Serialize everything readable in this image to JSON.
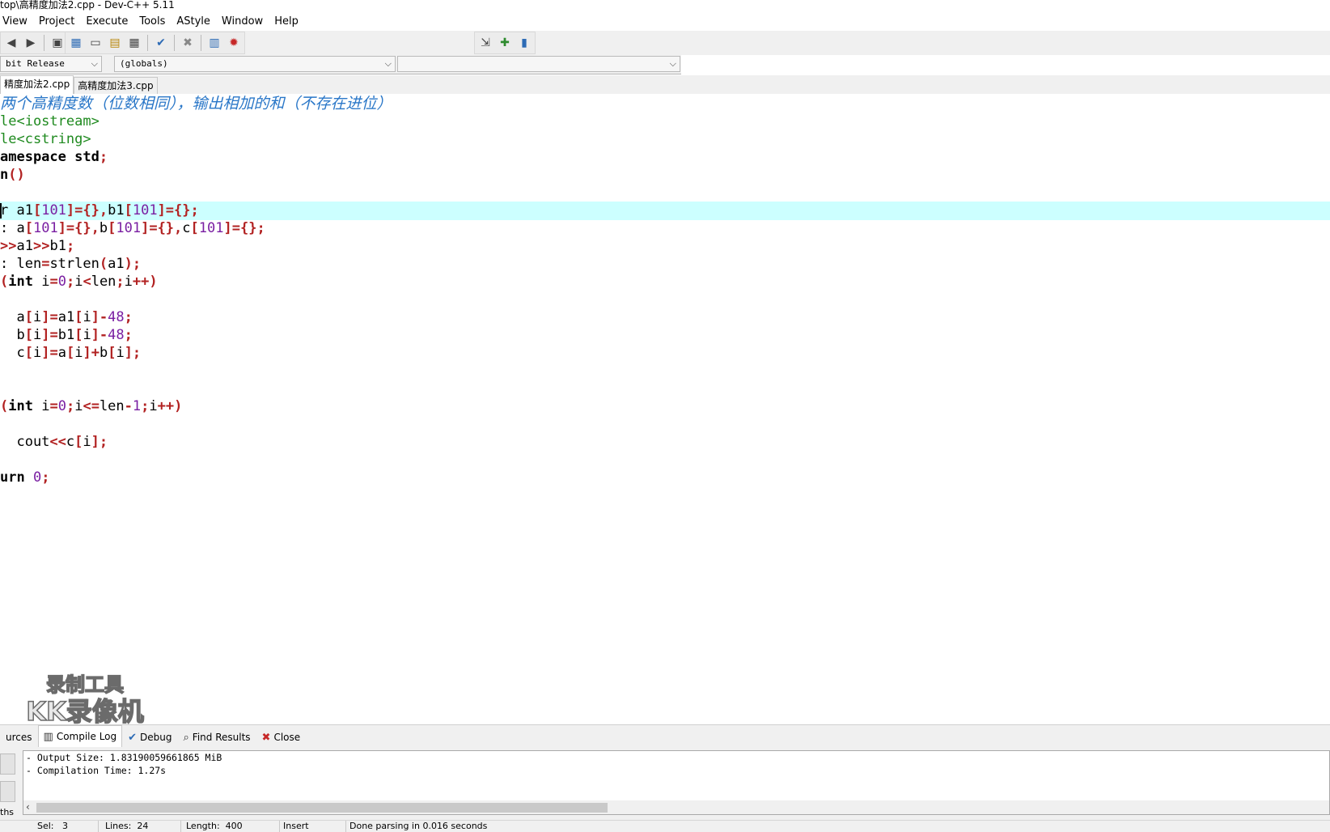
{
  "window": {
    "title": "top\\高精度加法2.cpp - Dev-C++ 5.11"
  },
  "menu": [
    "View",
    "Project",
    "Execute",
    "Tools",
    "AStyle",
    "Window",
    "Help"
  ],
  "toolbar": {
    "group1": [
      "undo-icon",
      "redo-icon",
      "save-icon"
    ],
    "group2": [
      "new-class-icon",
      "window-icon",
      "table-icon",
      "grid-icon",
      "check-icon",
      "delete-icon",
      "chart-icon",
      "bug-icon"
    ],
    "group3": [
      "goto-icon",
      "add-bookmark-icon",
      "bookmark-icon"
    ]
  },
  "selectors": {
    "compiler": "bit Release",
    "scope": "(globals)",
    "members": ""
  },
  "file_tabs": [
    "精度加法2.cpp",
    "高精度加法3.cpp"
  ],
  "colors": {
    "comment": "#2a77c8",
    "preprocessor": "#1f8a1f",
    "symbol": "#b22222",
    "number": "#7a1fa2",
    "highlight": "#ccffff"
  },
  "code_lines": [
    {
      "type": "comment",
      "parts": [
        [
          "两个高精度数（位数相同），输出相加的和（不存在进位）",
          "c"
        ]
      ]
    },
    {
      "type": "pre",
      "parts": [
        [
          "le<iostream>",
          "p"
        ]
      ]
    },
    {
      "type": "pre",
      "parts": [
        [
          "le<cstring>",
          "p"
        ]
      ]
    },
    {
      "type": "code",
      "parts": [
        [
          "amespace std",
          "b"
        ],
        [
          ";",
          "s"
        ]
      ]
    },
    {
      "type": "code",
      "parts": [
        [
          "n",
          "b"
        ],
        [
          "()",
          "s"
        ]
      ]
    },
    {
      "type": "code",
      "parts": []
    },
    {
      "type": "code",
      "hl": true,
      "parts": [
        [
          "r a1",
          "t"
        ],
        [
          "[",
          "s"
        ],
        [
          "101",
          "n"
        ],
        [
          "]={},",
          "s"
        ],
        [
          "b1",
          "t"
        ],
        [
          "[",
          "s"
        ],
        [
          "101",
          "n"
        ],
        [
          "]={};",
          "s"
        ]
      ]
    },
    {
      "type": "code",
      "parts": [
        [
          ": a",
          "t"
        ],
        [
          "[",
          "s"
        ],
        [
          "101",
          "n"
        ],
        [
          "]={},",
          "s"
        ],
        [
          "b",
          "t"
        ],
        [
          "[",
          "s"
        ],
        [
          "101",
          "n"
        ],
        [
          "]={},",
          "s"
        ],
        [
          "c",
          "t"
        ],
        [
          "[",
          "s"
        ],
        [
          "101",
          "n"
        ],
        [
          "]={};",
          "s"
        ]
      ]
    },
    {
      "type": "code",
      "parts": [
        [
          ">>",
          "s"
        ],
        [
          "a1",
          "t"
        ],
        [
          ">>",
          "s"
        ],
        [
          "b1",
          "t"
        ],
        [
          ";",
          "s"
        ]
      ]
    },
    {
      "type": "code",
      "parts": [
        [
          ": len",
          "t"
        ],
        [
          "=",
          "s"
        ],
        [
          "strlen",
          "t"
        ],
        [
          "(",
          "s"
        ],
        [
          "a1",
          "t"
        ],
        [
          ");",
          "s"
        ]
      ]
    },
    {
      "type": "code",
      "parts": [
        [
          "(",
          "s"
        ],
        [
          "int",
          "b"
        ],
        [
          " i",
          "t"
        ],
        [
          "=",
          "s"
        ],
        [
          "0",
          "n"
        ],
        [
          ";",
          "s"
        ],
        [
          "i",
          "t"
        ],
        [
          "<",
          "s"
        ],
        [
          "len",
          "t"
        ],
        [
          ";",
          "s"
        ],
        [
          "i",
          "t"
        ],
        [
          "++)",
          "s"
        ]
      ]
    },
    {
      "type": "code",
      "parts": []
    },
    {
      "type": "code",
      "parts": [
        [
          "  a",
          "t"
        ],
        [
          "[",
          "s"
        ],
        [
          "i",
          "t"
        ],
        [
          "]=",
          "s"
        ],
        [
          "a1",
          "t"
        ],
        [
          "[",
          "s"
        ],
        [
          "i",
          "t"
        ],
        [
          "]-",
          "s"
        ],
        [
          "48",
          "n"
        ],
        [
          ";",
          "s"
        ]
      ]
    },
    {
      "type": "code",
      "parts": [
        [
          "  b",
          "t"
        ],
        [
          "[",
          "s"
        ],
        [
          "i",
          "t"
        ],
        [
          "]=",
          "s"
        ],
        [
          "b1",
          "t"
        ],
        [
          "[",
          "s"
        ],
        [
          "i",
          "t"
        ],
        [
          "]-",
          "s"
        ],
        [
          "48",
          "n"
        ],
        [
          ";",
          "s"
        ]
      ]
    },
    {
      "type": "code",
      "parts": [
        [
          "  c",
          "t"
        ],
        [
          "[",
          "s"
        ],
        [
          "i",
          "t"
        ],
        [
          "]=",
          "s"
        ],
        [
          "a",
          "t"
        ],
        [
          "[",
          "s"
        ],
        [
          "i",
          "t"
        ],
        [
          "]+",
          "s"
        ],
        [
          "b",
          "t"
        ],
        [
          "[",
          "s"
        ],
        [
          "i",
          "t"
        ],
        [
          "];",
          "s"
        ]
      ]
    },
    {
      "type": "code",
      "parts": []
    },
    {
      "type": "code",
      "parts": []
    },
    {
      "type": "code",
      "parts": [
        [
          "(",
          "s"
        ],
        [
          "int",
          "b"
        ],
        [
          " i",
          "t"
        ],
        [
          "=",
          "s"
        ],
        [
          "0",
          "n"
        ],
        [
          ";",
          "s"
        ],
        [
          "i",
          "t"
        ],
        [
          "<=",
          "s"
        ],
        [
          "len",
          "t"
        ],
        [
          "-",
          "s"
        ],
        [
          "1",
          "n"
        ],
        [
          ";",
          "s"
        ],
        [
          "i",
          "t"
        ],
        [
          "++)",
          "s"
        ]
      ]
    },
    {
      "type": "code",
      "parts": []
    },
    {
      "type": "code",
      "parts": [
        [
          "  cout",
          "t"
        ],
        [
          "<<",
          "s"
        ],
        [
          "c",
          "t"
        ],
        [
          "[",
          "s"
        ],
        [
          "i",
          "t"
        ],
        [
          "];",
          "s"
        ]
      ]
    },
    {
      "type": "code",
      "parts": []
    },
    {
      "type": "code",
      "parts": [
        [
          "urn ",
          "b"
        ],
        [
          "0",
          "n"
        ],
        [
          ";",
          "s"
        ]
      ]
    }
  ],
  "watermark": {
    "line1": "录制工具",
    "line2": "KK录像机"
  },
  "bottom_tabs": [
    {
      "label": "urces",
      "icon": ""
    },
    {
      "label": "Compile Log",
      "icon": "chart-icon",
      "active": true
    },
    {
      "label": "Debug",
      "icon": "check-icon"
    },
    {
      "label": "Find Results",
      "icon": "search-icon"
    },
    {
      "label": "Close",
      "icon": "close-icon"
    }
  ],
  "compile_log": [
    "- Output Size: 1.83190059661865 MiB",
    "- Compilation Time: 1.27s"
  ],
  "left_panel_label": "ths",
  "status": {
    "sel_label": "Sel:",
    "sel": "3",
    "lines_label": "Lines:",
    "lines": "24",
    "length_label": "Length:",
    "length": "400",
    "mode": "Insert",
    "message": "Done parsing in 0.016 seconds"
  }
}
